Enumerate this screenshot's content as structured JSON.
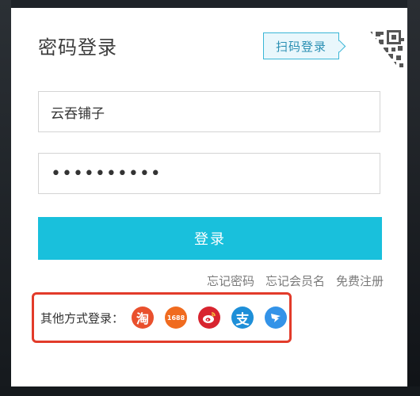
{
  "login": {
    "title": "密码登录",
    "qr_tooltip": "扫码登录",
    "username_value": "云吞铺子",
    "password_value": "••••••••••",
    "submit_label": "登录",
    "links": [
      "忘记密码",
      "忘记会员名",
      "免费注册"
    ],
    "other_label": "其他方式登录：",
    "social": [
      {
        "name": "taobao",
        "glyph": "淘",
        "color": "#e9502d"
      },
      {
        "name": "1688",
        "glyph": "1688",
        "color": "#f06b1f"
      },
      {
        "name": "weibo",
        "color": "#d8242f"
      },
      {
        "name": "alipay",
        "glyph": "支",
        "color": "#1e8fd8"
      },
      {
        "name": "dingtalk",
        "color": "#3393e8"
      }
    ],
    "accent_color": "#19c0dc",
    "highlight_color": "#e23b2a"
  }
}
